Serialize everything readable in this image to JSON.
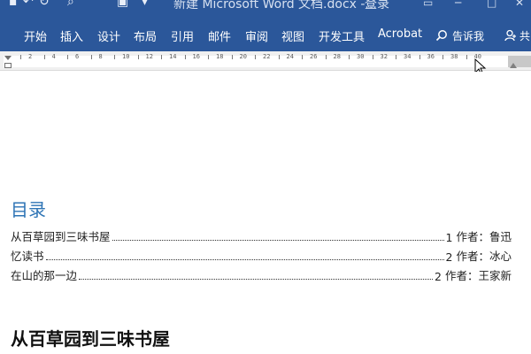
{
  "titlebar": {
    "document_title": "新建 Microsoft Word 文档.docx  -...",
    "login_label": "登录"
  },
  "ribbon": {
    "tabs": [
      "开始",
      "插入",
      "设计",
      "布局",
      "引用",
      "邮件",
      "审阅",
      "视图",
      "开发工具",
      "Acrobat"
    ],
    "tell_me_label": "告诉我",
    "share_label": "共"
  },
  "ruler": {
    "ticks": [
      "2",
      "4",
      "6",
      "8",
      "10",
      "12",
      "14",
      "16",
      "18",
      "20",
      "22",
      "24",
      "26",
      "28",
      "30",
      "32",
      "34",
      "36",
      "38",
      "40"
    ]
  },
  "document": {
    "toc_heading": "目录",
    "toc_entries": [
      {
        "title": "从百草园到三味书屋",
        "page": "1",
        "author": "作者：鲁迅"
      },
      {
        "title": "忆读书",
        "page": "2",
        "author": "作者：冰心"
      },
      {
        "title": "在山的那一边",
        "page": "2",
        "author": "作者：王家新"
      }
    ],
    "section_heading": "从百草园到三味书屋"
  },
  "colors": {
    "ribbon_blue": "#2b579a",
    "heading_blue": "#2e74b5"
  }
}
